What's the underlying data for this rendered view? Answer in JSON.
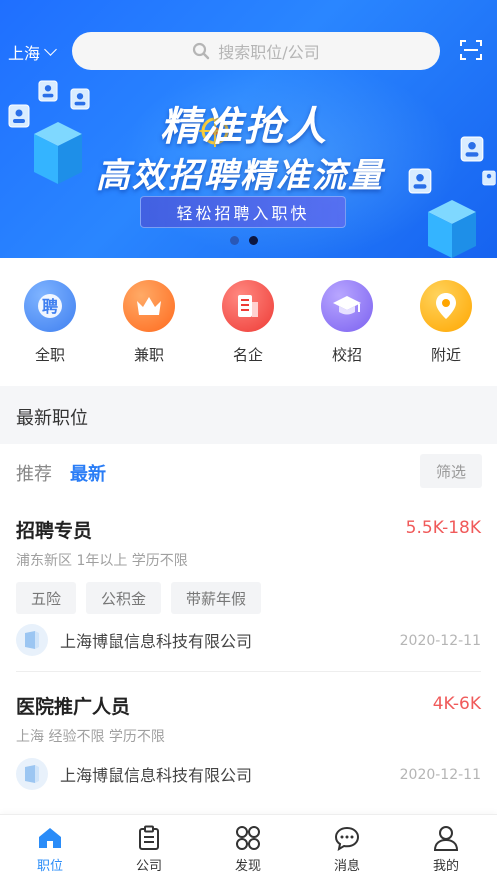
{
  "header": {
    "city": "上海",
    "search_placeholder": "搜索职位/公司",
    "scan_icon": "scan-icon"
  },
  "banner": {
    "title_line1": "精准抢人",
    "title_line2": "高效招聘精准流量",
    "pill": "轻松招聘入职快",
    "pages": 2,
    "active_page": 2
  },
  "categories": [
    {
      "label": "全职",
      "icon": "hire-icon",
      "color": "#4a8cf7"
    },
    {
      "label": "兼职",
      "icon": "crown-icon",
      "color": "#ff7a2e"
    },
    {
      "label": "名企",
      "icon": "building-icon",
      "color": "#f2504a"
    },
    {
      "label": "校招",
      "icon": "graduation-cap-icon",
      "color": "#8c74f5"
    },
    {
      "label": "附近",
      "icon": "location-pin-icon",
      "color": "#ffb21f"
    }
  ],
  "section": {
    "title": "最新职位"
  },
  "tabs": {
    "recommend": "推荐",
    "latest": "最新",
    "filter": "筛选"
  },
  "jobs": [
    {
      "title": "招聘专员",
      "salary": "5.5K-18K",
      "meta": "浦东新区  1年以上  学历不限",
      "tags": [
        "五险",
        "公积金",
        "带薪年假"
      ],
      "company": "上海博鼠信息科技有限公司",
      "date": "2020-12-11"
    },
    {
      "title": "医院推广人员",
      "salary": "4K-6K",
      "meta": "上海  经验不限  学历不限",
      "tags": [],
      "company": "上海博鼠信息科技有限公司",
      "date": "2020-12-11"
    }
  ],
  "nav": [
    {
      "label": "职位",
      "icon": "home-icon",
      "active": true
    },
    {
      "label": "公司",
      "icon": "clipboard-icon",
      "active": false
    },
    {
      "label": "发现",
      "icon": "grid-icon",
      "active": false
    },
    {
      "label": "消息",
      "icon": "chat-icon",
      "active": false
    },
    {
      "label": "我的",
      "icon": "user-icon",
      "active": false
    }
  ],
  "colors": {
    "accent": "#2a7df6",
    "salary": "#f05a5a",
    "banner": "#1f6fff"
  }
}
